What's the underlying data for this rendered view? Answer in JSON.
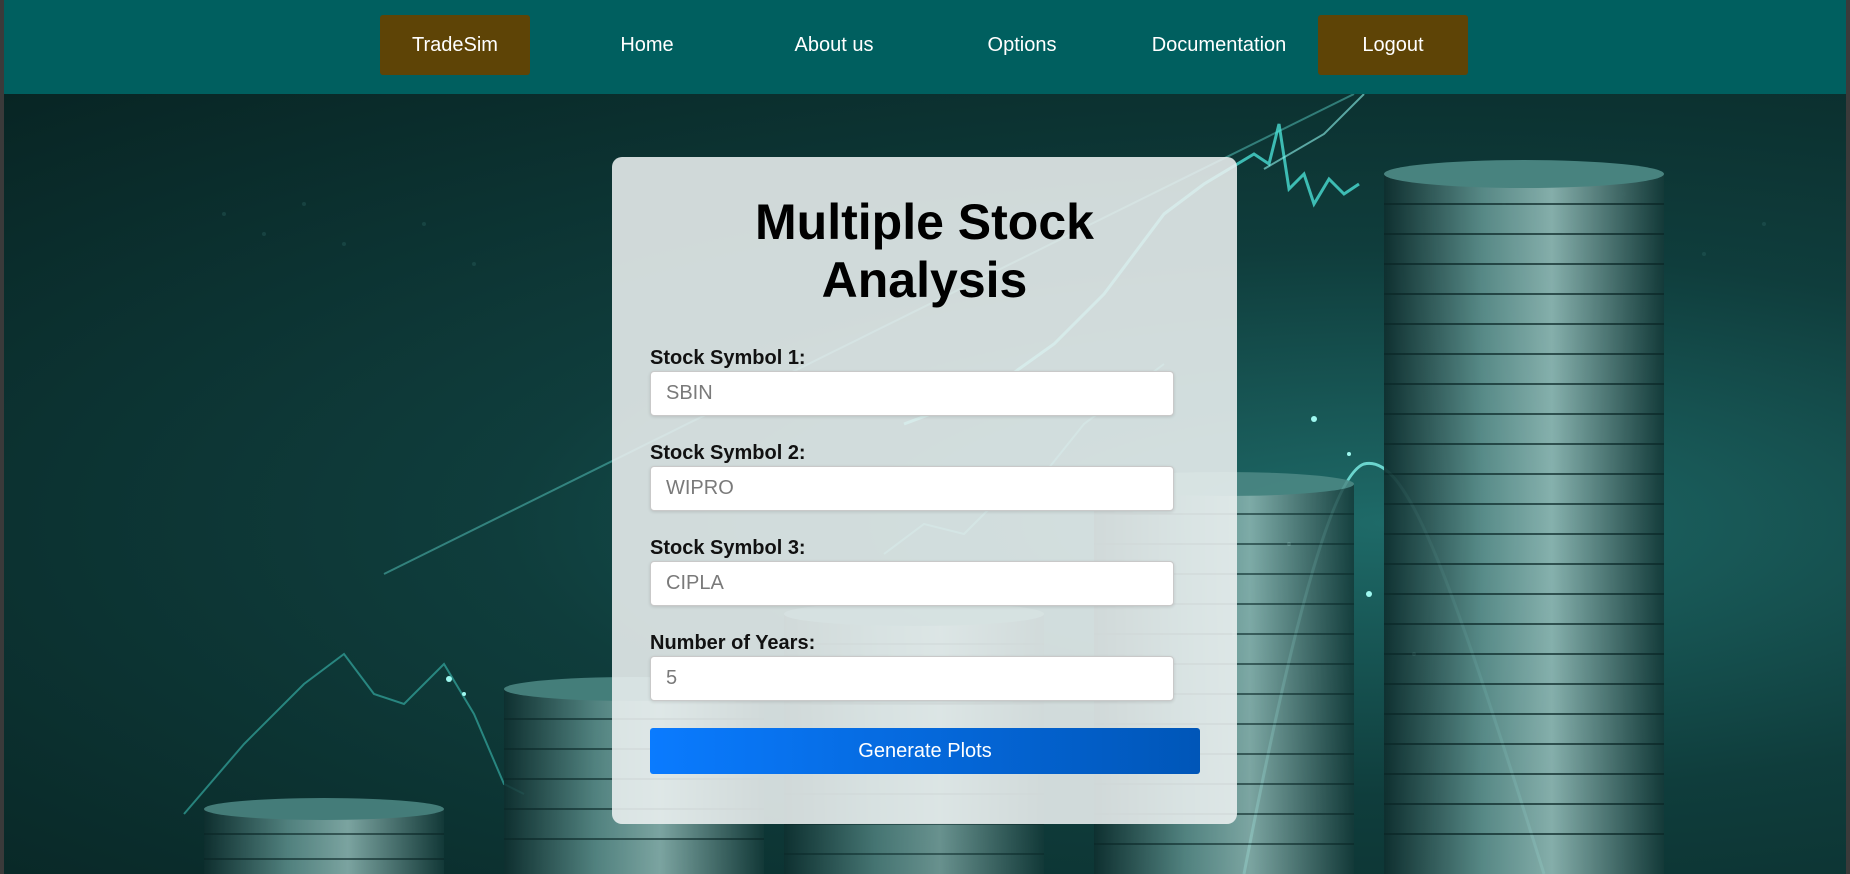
{
  "nav": {
    "items": [
      {
        "label": "TradeSim"
      },
      {
        "label": "Home"
      },
      {
        "label": "About us"
      },
      {
        "label": "Options"
      },
      {
        "label": "Documentation"
      },
      {
        "label": "Logout"
      }
    ]
  },
  "form": {
    "title": "Multiple Stock\nAnalysis",
    "fields": [
      {
        "label": "Stock Symbol 1:",
        "placeholder": "SBIN",
        "value": ""
      },
      {
        "label": "Stock Symbol 2:",
        "placeholder": "WIPRO",
        "value": ""
      },
      {
        "label": "Stock Symbol 3:",
        "placeholder": "CIPLA",
        "value": ""
      },
      {
        "label": "Number of Years:",
        "placeholder": "5",
        "value": ""
      }
    ],
    "submit_label": "Generate Plots"
  },
  "colors": {
    "navbar": "#005f5f",
    "nav_accent": "#5e4406",
    "button": "#0a7bff"
  },
  "background": {
    "icon": "coin-stacks-chart-background"
  }
}
